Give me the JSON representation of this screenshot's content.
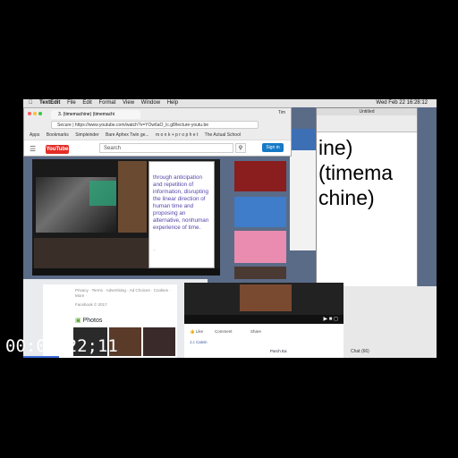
{
  "menubar": {
    "app": "TextEdit",
    "items": [
      "File",
      "Edit",
      "Format",
      "View",
      "Window",
      "Help"
    ],
    "clock": "Wed Feb 22  16:28:12"
  },
  "chrome": {
    "tab_title": "3. (timemachine) (timemachi",
    "url": "Secure | https://www.youtube.com/watch?v=YOw6aO_lc.g8/lecture-youtu.be",
    "bookmarks": [
      "Apps",
      "Bookmarks",
      "Simpleinder",
      "Bare Aphex Twin ge...",
      "m o n k + p r o p h e t",
      "The Actual School"
    ],
    "yt_logo": "YouTube",
    "search_placeholder": "Search",
    "signin": "Sign in",
    "profile": "Tim"
  },
  "video_text": {
    "body": "through anticipation and repetition of information, disrupting the linear direction of human time and proposing an alternative, nonhuman experience of time."
  },
  "textedit": {
    "title": "Untitled",
    "content_line1": "ine)",
    "content_line2": "(timema",
    "content_line3": "chine)"
  },
  "facebook": {
    "links": "Privacy · Terms · Advertising · Ad Choices · Cookies · More ·",
    "copyright": "Facebook © 2017",
    "photos_label": "Photos",
    "like": "Like",
    "comment": "Comment",
    "share": "Share",
    "commenter": "J.c Calvin",
    "name2": "Parch Ea",
    "chat": "Chat (66)"
  },
  "timecode": "00:00:22;11",
  "colors": {
    "youtube_red": "#e52d27",
    "text_purple": "#5544aa",
    "background": "#000000"
  }
}
